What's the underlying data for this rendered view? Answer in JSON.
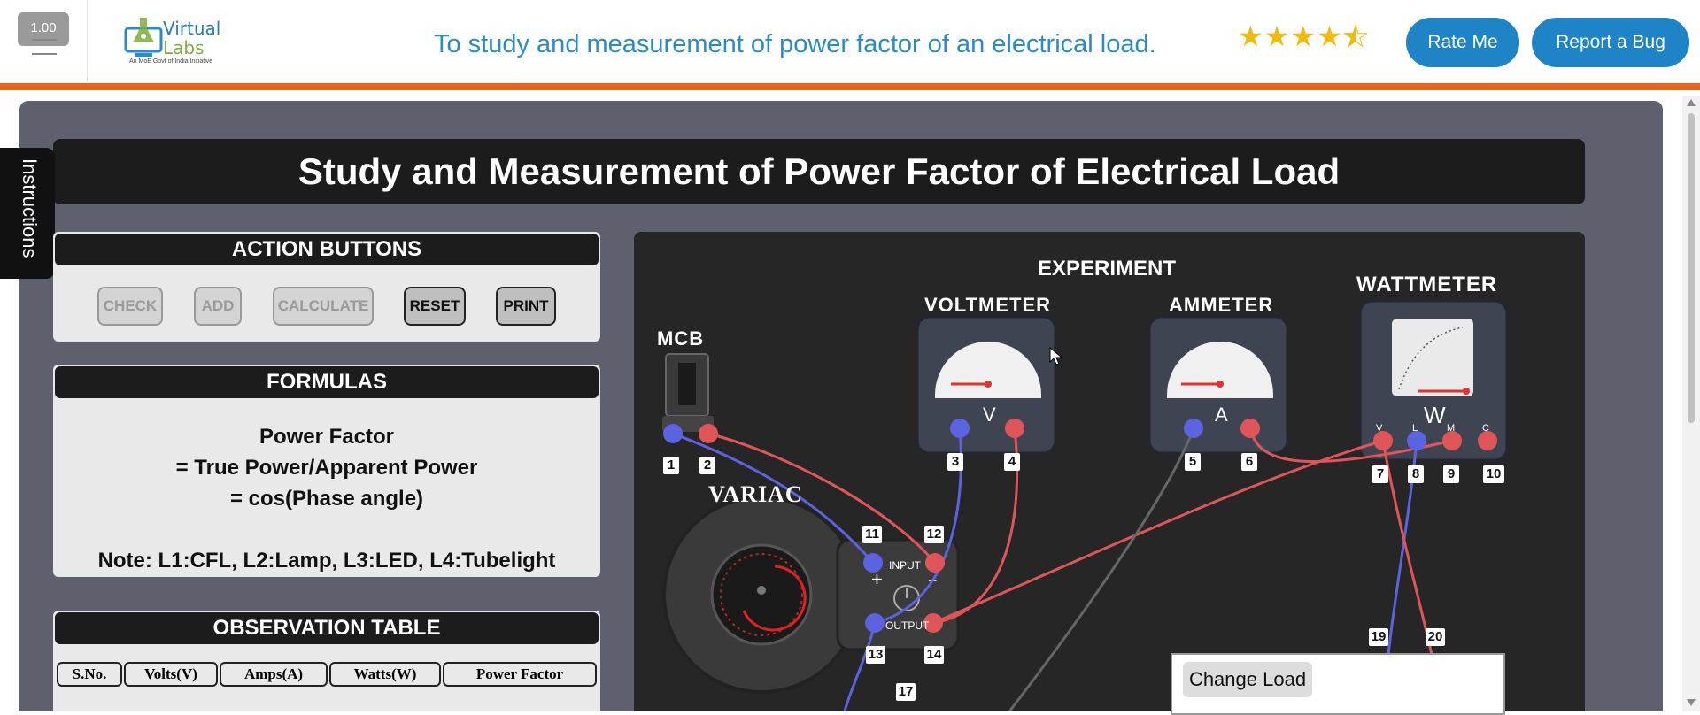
{
  "header": {
    "version": "1.00",
    "logo_line1": "Virtual",
    "logo_line2": "Labs",
    "logo_sub": "An MoE Govt of India Initiative",
    "page_title": "To study and measurement of power factor of an electrical load.",
    "rating": 4.5,
    "rate_label": "Rate Me",
    "bug_label": "Report a Bug"
  },
  "instructions_label": "Instructions",
  "main_title": "Study and Measurement of Power Factor of Electrical Load",
  "action_panel": {
    "title": "ACTION BUTTONS",
    "buttons": [
      "CHECK",
      "ADD",
      "CALCULATE",
      "RESET",
      "PRINT"
    ]
  },
  "formulas": {
    "title": "FORMULAS",
    "line1": "Power Factor",
    "line2": "= True Power/Apparent Power",
    "line3": "= cos(Phase angle)",
    "note": "Note: L1:CFL, L2:Lamp, L3:LED, L4:Tubelight"
  },
  "observation": {
    "title": "OBSERVATION TABLE",
    "columns": [
      "S.No.",
      "Volts(V)",
      "Amps(A)",
      "Watts(W)",
      "Power Factor"
    ]
  },
  "experiment": {
    "title": "EXPERIMENT",
    "mcb": "MCB",
    "variac": "VARIAC",
    "voltmeter": "VOLTMETER",
    "ammeter": "AMMETER",
    "wattmeter": "WATTMETER",
    "v_symbol": "V",
    "a_symbol": "A",
    "w_symbol": "W",
    "input_label": "INPUT",
    "output_label": "OUTPUT",
    "terminals": [
      "1",
      "2",
      "3",
      "4",
      "5",
      "6",
      "7",
      "8",
      "9",
      "10",
      "11",
      "12",
      "13",
      "14",
      "17",
      "19",
      "20"
    ],
    "wattmeter_terms": [
      "V",
      "L",
      "M",
      "C"
    ],
    "change_load": "Change Load"
  },
  "colors": {
    "accent_orange": "#e8651b",
    "button_blue": "#1f84c6",
    "wire_blue": "#5b63e0",
    "wire_red": "#e05558"
  }
}
